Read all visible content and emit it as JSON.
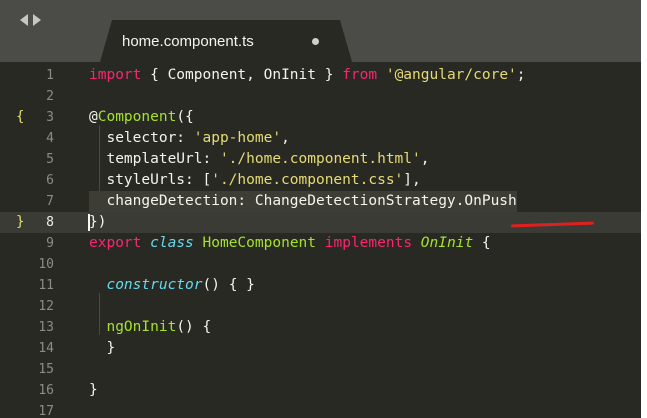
{
  "window": {
    "tab": {
      "filename": "home.component.ts"
    }
  },
  "editor": {
    "lines": [
      {
        "n": "1",
        "segments": [
          {
            "t": "import",
            "c": "kw"
          },
          {
            "t": " { Component, OnInit } ",
            "c": ""
          },
          {
            "t": "from",
            "c": "kw"
          },
          {
            "t": " ",
            "c": ""
          },
          {
            "t": "'@angular/core'",
            "c": "str"
          },
          {
            "t": ";",
            "c": ""
          }
        ]
      },
      {
        "n": "2",
        "segments": []
      },
      {
        "n": "3",
        "fold": "{",
        "segments": [
          {
            "t": "@",
            "c": ""
          },
          {
            "t": "Component",
            "c": "fn"
          },
          {
            "t": "({",
            "c": ""
          }
        ]
      },
      {
        "n": "4",
        "segments": [
          {
            "t": "  selector: ",
            "c": ""
          },
          {
            "t": "'app-home'",
            "c": "str"
          },
          {
            "t": ",",
            "c": ""
          }
        ]
      },
      {
        "n": "5",
        "segments": [
          {
            "t": "  templateUrl: ",
            "c": ""
          },
          {
            "t": "'./home.component.html'",
            "c": "str"
          },
          {
            "t": ",",
            "c": ""
          }
        ]
      },
      {
        "n": "6",
        "segments": [
          {
            "t": "  styleUrls: [",
            "c": ""
          },
          {
            "t": "'./home.component.css'",
            "c": "str"
          },
          {
            "t": "],",
            "c": ""
          }
        ]
      },
      {
        "n": "7",
        "highlight": true,
        "segments": [
          {
            "t": "  changeDetection: ChangeDetectionStrategy.OnPush",
            "c": ""
          }
        ]
      },
      {
        "n": "8",
        "fold": "}",
        "active": true,
        "segments": [
          {
            "t": "})",
            "c": ""
          }
        ]
      },
      {
        "n": "9",
        "segments": [
          {
            "t": "export",
            "c": "kw"
          },
          {
            "t": " ",
            "c": ""
          },
          {
            "t": "class",
            "c": "itk"
          },
          {
            "t": " ",
            "c": ""
          },
          {
            "t": "HomeComponent",
            "c": "fn"
          },
          {
            "t": " ",
            "c": ""
          },
          {
            "t": "implements",
            "c": "kw"
          },
          {
            "t": " ",
            "c": ""
          },
          {
            "t": "OnInit",
            "c": "st"
          },
          {
            "t": " {",
            "c": ""
          }
        ]
      },
      {
        "n": "10",
        "segments": []
      },
      {
        "n": "11",
        "segments": [
          {
            "t": "  ",
            "c": ""
          },
          {
            "t": "constructor",
            "c": "itk"
          },
          {
            "t": "() { }",
            "c": ""
          }
        ]
      },
      {
        "n": "12",
        "segments": []
      },
      {
        "n": "13",
        "segments": [
          {
            "t": "  ",
            "c": ""
          },
          {
            "t": "ngOnInit",
            "c": "fn"
          },
          {
            "t": "() {",
            "c": ""
          }
        ]
      },
      {
        "n": "14",
        "segments": [
          {
            "t": "  }",
            "c": ""
          }
        ]
      },
      {
        "n": "15",
        "segments": []
      },
      {
        "n": "16",
        "segments": [
          {
            "t": "}",
            "c": ""
          }
        ]
      },
      {
        "n": "17",
        "segments": []
      }
    ]
  },
  "colors": {
    "background": "#282923",
    "keyword": "#f92672",
    "string": "#e6db74",
    "function": "#a6e22e",
    "storage_type": "#66d9ef",
    "annotation_underline": "#e02020"
  }
}
